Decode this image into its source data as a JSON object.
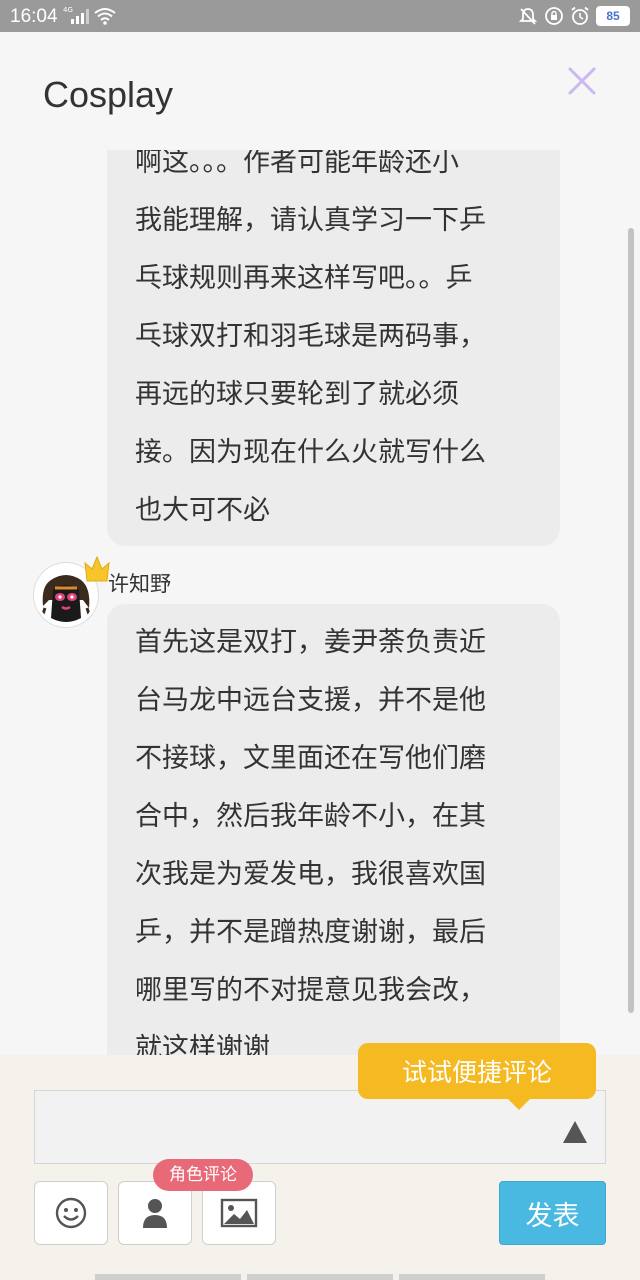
{
  "status_bar": {
    "time": "16:04",
    "network": "4G",
    "battery": "85"
  },
  "header": {
    "title": "Cosplay",
    "close_icon": "close-icon",
    "close_color": "#c9b8f2"
  },
  "comments": [
    {
      "text": "啊这。。。作者可能年龄还小\n我能理解，请认真学习一下乒\n乓球规则再来这样写吧。。乒\n乓球双打和羽毛球是两码事，\n再远的球只要轮到了就必须\n接。因为现在什么火就写什么\n也大可不必"
    },
    {
      "username": "许知野",
      "text": "首先这是双打，姜尹荼负责近\n台马龙中远台支援，并不是他\n不接球，文里面还在写他们磨\n合中，然后我年龄不小，在其\n次我是为爱发电，我很喜欢国\n乒，并不是蹭热度谢谢，最后\n哪里写的不对提意见我会改，\n就这样谢谢"
    }
  ],
  "compose": {
    "quick_comment_tip": "试试便捷评论",
    "role_comment_tag": "角色评论",
    "post_button": "发表",
    "input_value": "",
    "colors": {
      "post_button": "#49b9e2",
      "quick_tip": "#f5b921",
      "role_tag": "#e86a78"
    }
  }
}
